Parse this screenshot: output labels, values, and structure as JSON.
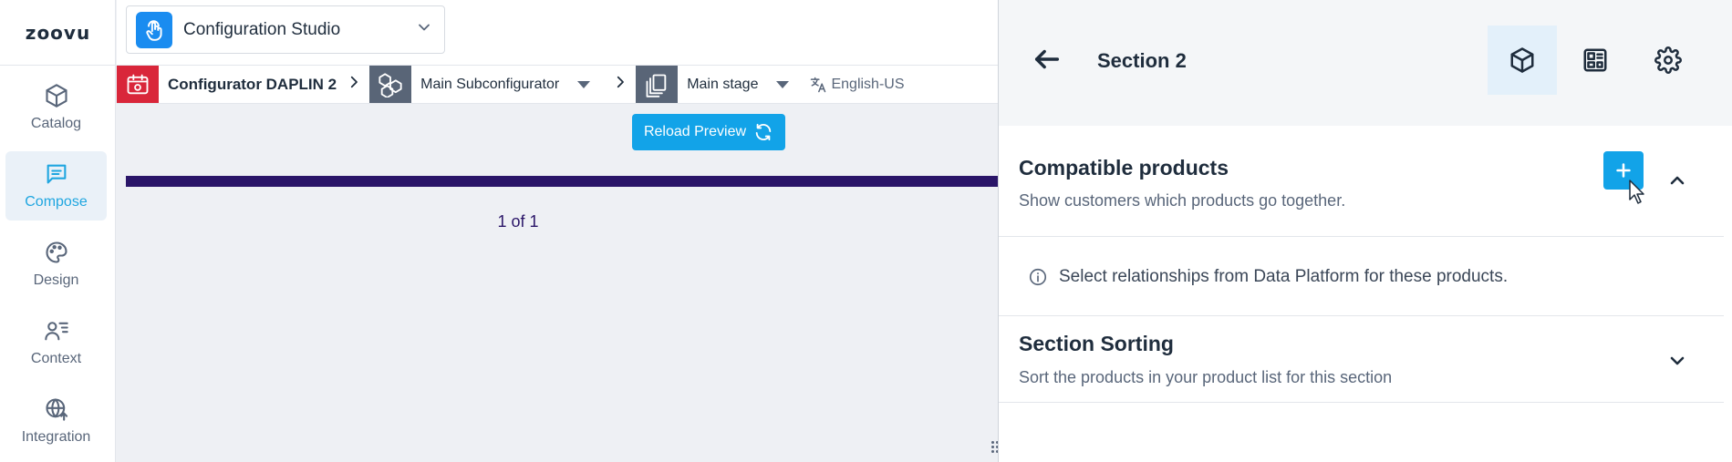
{
  "brand": {
    "logo_text": "zoovu"
  },
  "nav": {
    "items": [
      {
        "label": "Catalog",
        "icon": "cube-icon",
        "active": false
      },
      {
        "label": "Compose",
        "icon": "message-square-icon",
        "active": true
      },
      {
        "label": "Design",
        "icon": "palette-icon",
        "active": false
      },
      {
        "label": "Context",
        "icon": "user-list-icon",
        "active": false
      },
      {
        "label": "Integration",
        "icon": "globe-upload-icon",
        "active": false
      }
    ]
  },
  "studio_select": {
    "label": "Configuration Studio",
    "icon": "touch-hand-icon"
  },
  "breadcrumb": {
    "configurator": "Configurator DAPLIN 2",
    "subconfigurator": "Main Subconfigurator",
    "stage": "Main stage",
    "language": "English-US"
  },
  "preview": {
    "reload_label": "Reload Preview",
    "pager": "1 of 1"
  },
  "panel": {
    "title": "Section 2",
    "tabs": [
      {
        "icon": "cube-icon",
        "active": true
      },
      {
        "icon": "layout-dashboard-icon",
        "active": false
      },
      {
        "icon": "gear-icon",
        "active": false
      }
    ],
    "sections": [
      {
        "title": "Compatible products",
        "subtitle": "Show customers which products go together.",
        "expanded": true,
        "info": "Select relationships from Data Platform for these products."
      },
      {
        "title": "Section Sorting",
        "subtitle": "Sort the products in your product list for this section",
        "expanded": false
      }
    ]
  },
  "colors": {
    "accent": "#12a3e8",
    "nav_active_bg": "#eaf1f8",
    "configurator_red": "#d9263a",
    "preview_bar": "#2a1568"
  }
}
